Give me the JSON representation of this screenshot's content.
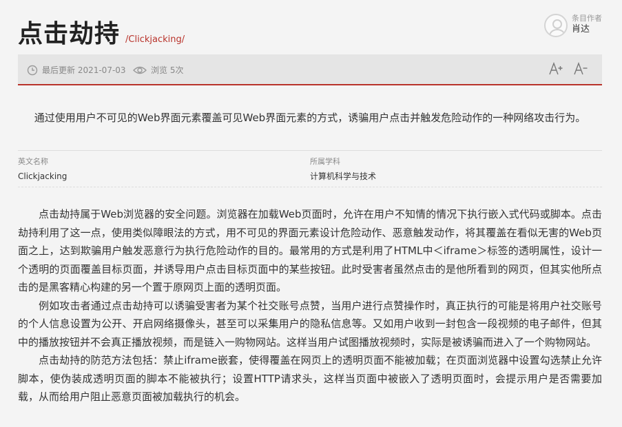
{
  "header": {
    "title": "点击劫持",
    "subtitle": "/Clickjacking/"
  },
  "author": {
    "label": "条目作者",
    "name": "肖达"
  },
  "toolbar": {
    "updated": "最后更新 2021-07-03",
    "views": "浏览 5次",
    "icons": [
      "clock-icon",
      "eye-icon",
      "font-increase-icon",
      "font-decrease-icon"
    ]
  },
  "abstract": "通过使用用户不可见的Web界面元素覆盖可见Web界面元素的方式，诱骗用户点击并触发危险动作的一种网络攻击行为。",
  "info": {
    "english_label": "英文名称",
    "english_value": "Clickjacking",
    "discipline_label": "所属学科",
    "discipline_value": "计算机科学与技术"
  },
  "content": {
    "paragraphs": [
      "点击劫持属于Web浏览器的安全问题。浏览器在加载Web页面时，允许在用户不知情的情况下执行嵌入式代码或脚本。点击劫持利用了这一点，使用类似障眼法的方式，用不可见的界面元素设计危险动作、恶意触发动作，将其覆盖在看似无害的Web页面之上，达到欺骗用户触发恶意行为执行危险动作的目的。最常用的方式是利用了HTML中＜iframe＞标签的透明属性，设计一个透明的页面覆盖目标页面，并诱导用户点击目标页面中的某些按钮。此时受害者虽然点击的是他所看到的网页，但其实他所点击的是黑客精心构建的另一个置于原网页上面的透明页面。",
      "例如攻击者通过点击劫持可以诱骗受害者为某个社交账号点赞，当用户进行点赞操作时，真正执行的可能是将用户社交账号的个人信息设置为公开、开启网络摄像头，甚至可以采集用户的隐私信息等。又如用户收到一封包含一段视频的电子邮件，但其中的播放按钮并不会真正播放视频，而是链入一购物网站。这样当用户试图播放视频时，实际是被诱骗而进入了一个购物网站。",
      "点击劫持的防范方法包括：禁止iframe嵌套，使得覆盖在网页上的透明页面不能被加载；在页面浏览器中设置勾选禁止允许脚本，使伪装成透明页面的脚本不能被执行；设置HTTP请求头，这样当页面中被嵌入了透明页面时，会提示用户是否需要加载，从而给用户阻止恶意页面被加载执行的机会。"
    ]
  }
}
